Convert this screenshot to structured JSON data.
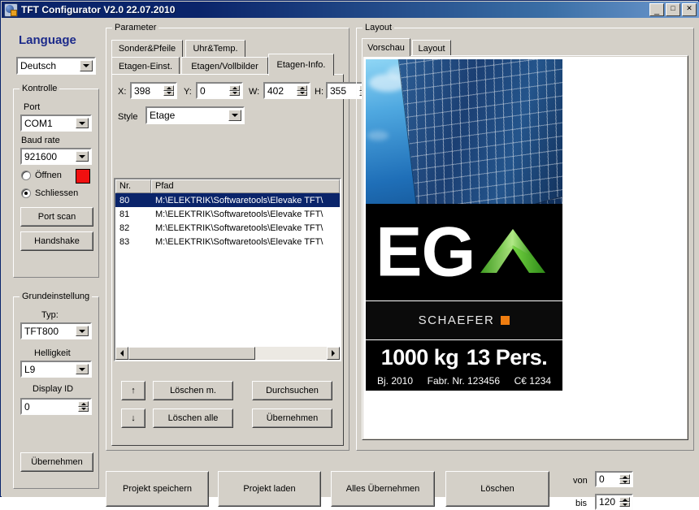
{
  "window": {
    "title": "TFT Configurator V2.0   22.07.2010",
    "icon": "app-globe-icon",
    "buttons": {
      "minimize": "_",
      "maximize": "□",
      "close": "✕"
    }
  },
  "language_panel": {
    "heading": "Language",
    "heading_color": "#1c2a8a",
    "selected": "Deutsch"
  },
  "kontrolle": {
    "legend": "Kontrolle",
    "port_label": "Port",
    "port_value": "COM1",
    "baud_label": "Baud rate",
    "baud_value": "921600",
    "radio_open": "Öffnen",
    "radio_close": "Schliessen",
    "radio_selected": "Schliessen",
    "status_color": "#f01010",
    "btn_port_scan": "Port scan",
    "btn_handshake": "Handshake"
  },
  "grundeinstellung": {
    "legend": "Grundeinstellung",
    "typ_label": "Typ:",
    "typ_value": "TFT800",
    "helligkeit_label": "Helligkeit",
    "helligkeit_value": "L9",
    "display_id_label": "Display ID",
    "display_id_value": "0",
    "btn_uebernehmen": "Übernehmen"
  },
  "parameter": {
    "legend": "Parameter",
    "tabs_row1": [
      {
        "label": "Sonder&Pfeile",
        "selected": false
      },
      {
        "label": "Uhr&Temp.",
        "selected": false
      }
    ],
    "tabs_row2": [
      {
        "label": "Etagen-Einst.",
        "selected": false
      },
      {
        "label": "Etagen/Vollbilder",
        "selected": false
      },
      {
        "label": "Etagen-Info.",
        "selected": true
      }
    ],
    "coords": [
      {
        "label": "X:",
        "value": "398"
      },
      {
        "label": "Y:",
        "value": "0"
      },
      {
        "label": "W:",
        "value": "402"
      },
      {
        "label": "H:",
        "value": "355"
      }
    ],
    "style_label": "Style",
    "style_value": "Etage",
    "list": {
      "columns": [
        "Nr.",
        "Pfad"
      ],
      "rows": [
        {
          "nr": "80",
          "pfad": "M:\\ELEKTRIK\\Softwaretools\\Elevake TFT\\",
          "selected": true
        },
        {
          "nr": "81",
          "pfad": "M:\\ELEKTRIK\\Softwaretools\\Elevake TFT\\",
          "selected": false
        },
        {
          "nr": "82",
          "pfad": "M:\\ELEKTRIK\\Softwaretools\\Elevake TFT\\",
          "selected": false
        },
        {
          "nr": "83",
          "pfad": "M:\\ELEKTRIK\\Softwaretools\\Elevake TFT\\",
          "selected": false
        }
      ]
    },
    "buttons": {
      "up": "↑",
      "down": "↓",
      "loeschen_m": "Löschen m.",
      "loeschen_alle": "Löschen alle",
      "durchsuchen": "Durchsuchen",
      "uebernehmen": "Übernehmen"
    }
  },
  "layout": {
    "legend": "Layout",
    "tabs": [
      {
        "label": "Vorschau",
        "selected": true
      },
      {
        "label": "Layout",
        "selected": false
      }
    ],
    "preview": {
      "floor_text": "EG",
      "arrow_direction": "up",
      "arrow_color": "#6fcf3f",
      "brand": "SCHAEFER",
      "brand_square_color": "#ef7d10",
      "load_kg": "1000 kg",
      "persons": "13  Pers.",
      "year": "Bj. 2010",
      "fabr": "Fabr. Nr. 123456",
      "ce": "C€ 1234"
    }
  },
  "bottom_bar": {
    "buttons": [
      "Projekt speichern",
      "Projekt laden",
      "Alles Übernehmen",
      "Löschen"
    ],
    "range": {
      "von_label": "von",
      "von_value": "0",
      "bis_label": "bis",
      "bis_value": "120"
    }
  }
}
